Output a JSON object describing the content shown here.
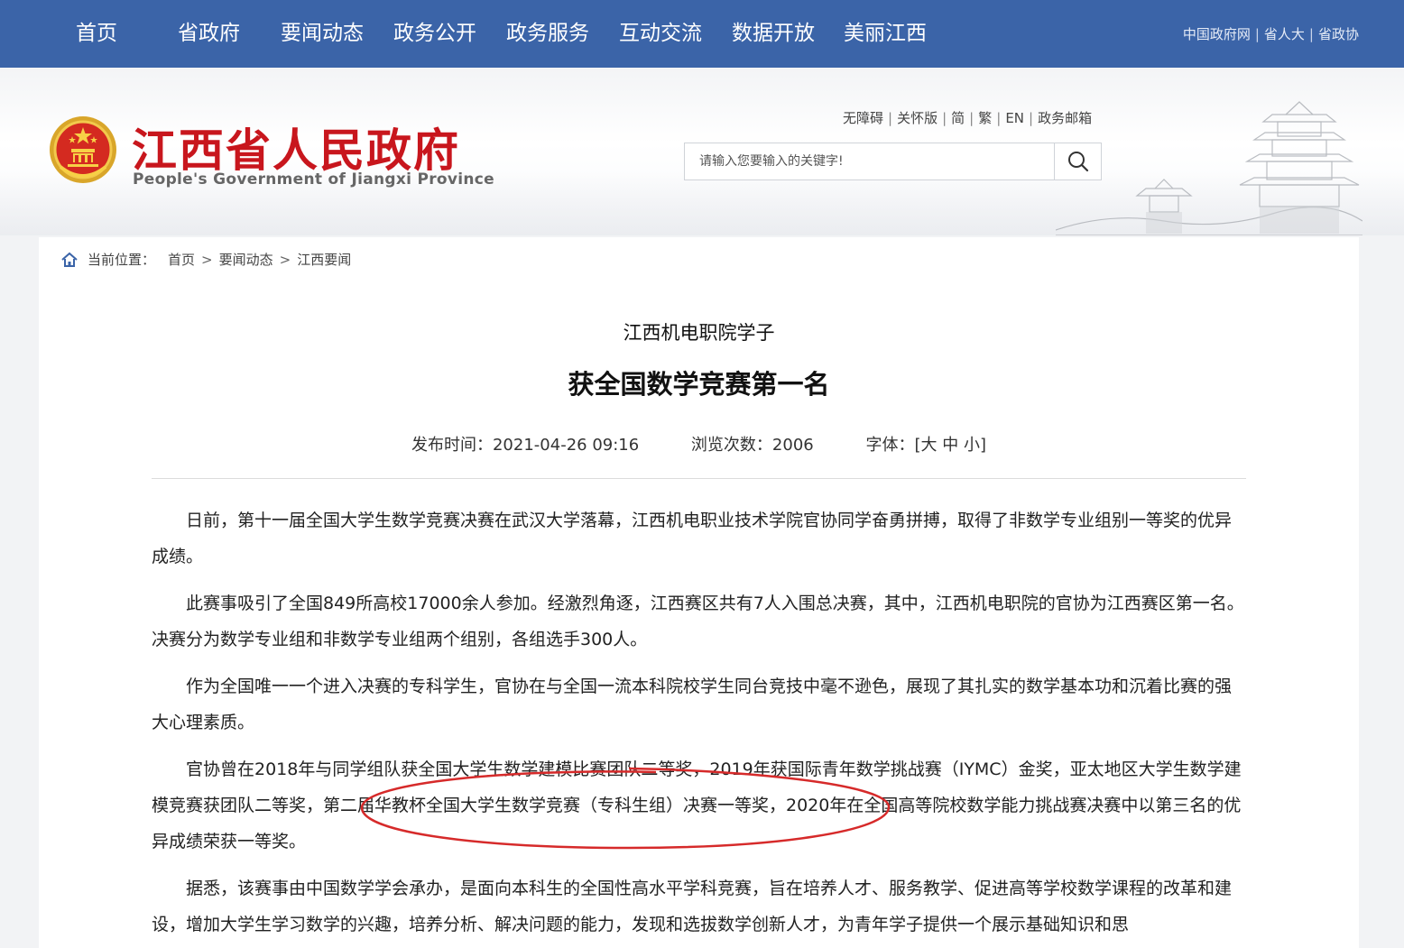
{
  "topnav": {
    "items": [
      "首页",
      "省政府",
      "要闻动态",
      "政务公开",
      "政务服务",
      "互动交流",
      "数据开放",
      "美丽江西"
    ],
    "external_links": [
      "中国政府网",
      "省人大",
      "省政协"
    ],
    "bg_color": "#3b64a8"
  },
  "header": {
    "title": "江西省人民政府",
    "subtitle": "People's Government of Jiangxi Province",
    "title_color": "#c8161d",
    "util_links": [
      "无障碍",
      "关怀版",
      "简",
      "繁",
      "EN",
      "政务邮箱"
    ],
    "search": {
      "placeholder": "请输入您要输入的关键字!",
      "icon": "search-icon"
    }
  },
  "breadcrumb": {
    "label": "当前位置：",
    "items": [
      "首页",
      "要闻动态",
      "江西要闻"
    ],
    "separator": ">"
  },
  "article": {
    "subtitle": "江西机电职院学子",
    "title": "获全国数学竞赛第一名",
    "publish_label": "发布时间：",
    "publish_time": "2021-04-26 09:16",
    "views_label": "浏览次数：",
    "views": "2006",
    "font_label": "字体：",
    "font_open": "[",
    "font_sizes": [
      "大",
      "中",
      "小"
    ],
    "font_close": "]",
    "paragraphs": [
      "日前，第十一届全国大学生数学竞赛决赛在武汉大学落幕，江西机电职业技术学院官协同学奋勇拼搏，取得了非数学专业组别一等奖的优异成绩。",
      "此赛事吸引了全国849所高校17000余人参加。经激烈角逐，江西赛区共有7人入围总决赛，其中，江西机电职院的官协为江西赛区第一名。决赛分为数学专业组和非数学专业组两个组别，各组选手300人。",
      "作为全国唯一一个进入决赛的专科学生，官协在与全国一流本科院校学生同台竞技中毫不逊色，展现了其扎实的数学基本功和沉着比赛的强大心理素质。",
      "官协曾在2018年与同学组队获全国大学生数学建模比赛团队二等奖，2019年获国际青年数学挑战赛（IYMC）金奖，亚太地区大学生数学建模竞赛获团队二等奖，第二届华教杯全国大学生数学竞赛（专科生组）决赛一等奖，2020年在全国高等院校数学能力挑战赛决赛中以第三名的优异成绩荣获一等奖。",
      "据悉，该赛事由中国数学学会承办，是面向本科生的全国性高水平学科竞赛，旨在培养人才、服务教学、促进高等学校数学课程的改革和建设，增加大学生学习数学的兴趣，培养分析、解决问题的能力，发现和选拔数学创新人才，为青年学子提供一个展示基础知识和思"
    ]
  },
  "annotation_color": "#d62a2a"
}
